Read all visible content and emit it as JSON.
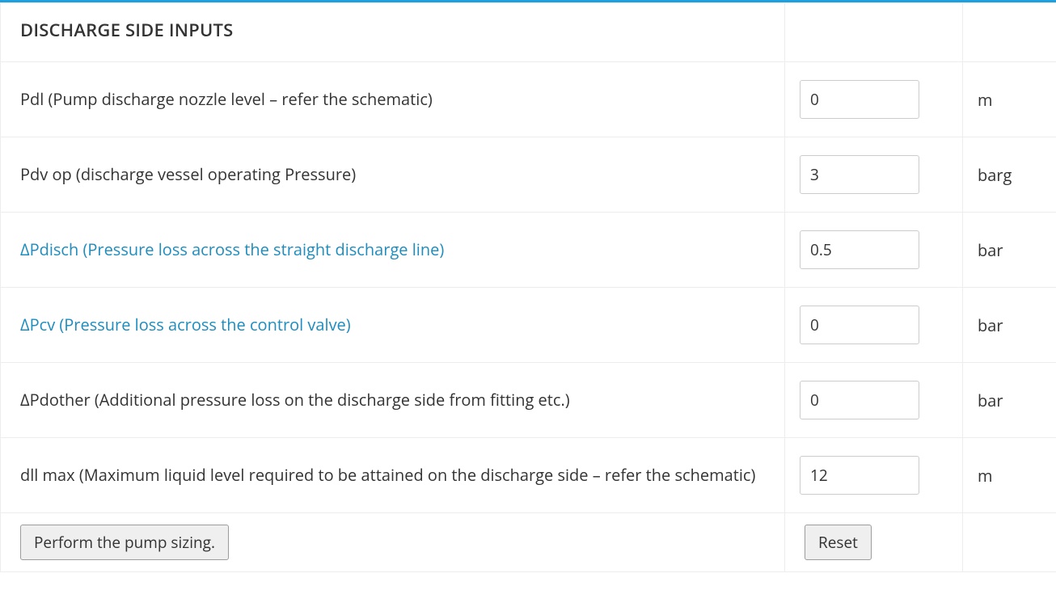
{
  "header": {
    "title": "DISCHARGE SIDE INPUTS"
  },
  "rows": [
    {
      "label": "Pdl (Pump discharge nozzle level – refer the schematic)",
      "value": "0",
      "unit": "m",
      "link": false
    },
    {
      "label": "Pdv op (discharge vessel operating Pressure)",
      "value": "3",
      "unit": "barg",
      "link": false
    },
    {
      "label": "ΔPdisch (Pressure loss across the straight discharge line)",
      "value": "0.5",
      "unit": "bar",
      "link": true
    },
    {
      "label": "ΔPcv (Pressure loss across the control valve)",
      "value": "0",
      "unit": "bar",
      "link": true
    },
    {
      "label": "ΔPdother (Additional pressure loss on the discharge side from fitting etc.)",
      "value": "0",
      "unit": "bar",
      "link": false
    },
    {
      "label": "dll max (Maximum liquid level required to be attained on the discharge side – refer the schematic)",
      "value": "12",
      "unit": "m",
      "link": false
    }
  ],
  "actions": {
    "submit_label": "Perform the pump sizing.",
    "reset_label": "Reset"
  }
}
